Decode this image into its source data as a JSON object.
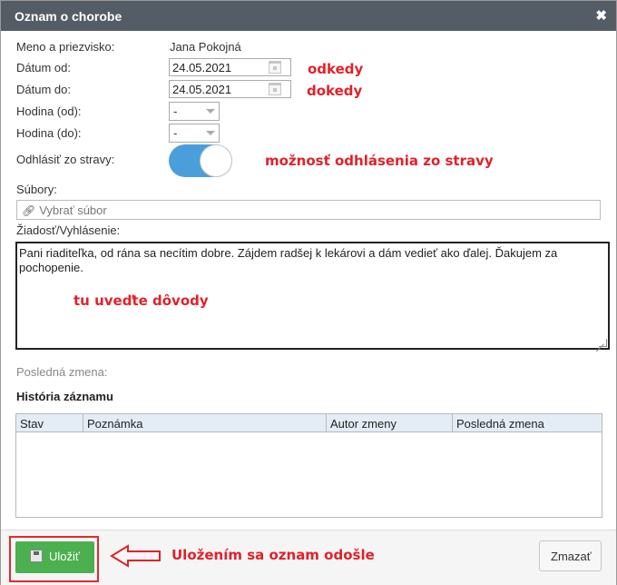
{
  "dialog": {
    "title": "Oznam o chorobe",
    "close_glyph": "✖"
  },
  "form": {
    "name_label": "Meno a priezvisko:",
    "name_value": "Jana Pokojná",
    "date_from_label": "Dátum od:",
    "date_from_value": "24.05.2021",
    "date_to_label": "Dátum do:",
    "date_to_value": "24.05.2021",
    "hour_from_label": "Hodina (od):",
    "hour_from_value": "-",
    "hour_to_label": "Hodina (do):",
    "hour_to_value": "-",
    "meal_label": "Odhlásiť zo stravy:",
    "meal_toggle_on": true,
    "files_label": "Súbory:",
    "file_placeholder": "Vybrať súbor",
    "request_label": "Žiadosť/Vyhlásenie:",
    "request_text": "Pani riaditeľka, od rána sa necítim dobre. Zájdem radšej k lekárovi a dám vedieť ako ďalej. Ďakujem za pochopenie.",
    "last_change_label": "Posledná zmena:",
    "history_title": "História záznamu"
  },
  "history_table": {
    "columns": [
      "Stav",
      "Poznámka",
      "Autor zmeny",
      "Posledná zmena"
    ],
    "rows": []
  },
  "footer": {
    "save_label": "Uložiť",
    "clear_label": "Zmazať"
  },
  "annotations": {
    "from": "odkedy",
    "to": "dokedy",
    "meal": "možnosť odhlásenia zo stravy",
    "reasons": "tu uveďte dôvody",
    "save": "Uložením sa oznam odošle"
  },
  "colors": {
    "titlebar": "#545d65",
    "toggle_on": "#4a9fdb",
    "save_button": "#4caf50",
    "annotation": "#e0222a",
    "table_header": "#e4edf5"
  },
  "icons": [
    "close-icon",
    "calendar-icon",
    "chevron-down-icon",
    "link-icon",
    "floppy-disk-icon",
    "resize-grip-icon",
    "arrow-left-icon"
  ]
}
